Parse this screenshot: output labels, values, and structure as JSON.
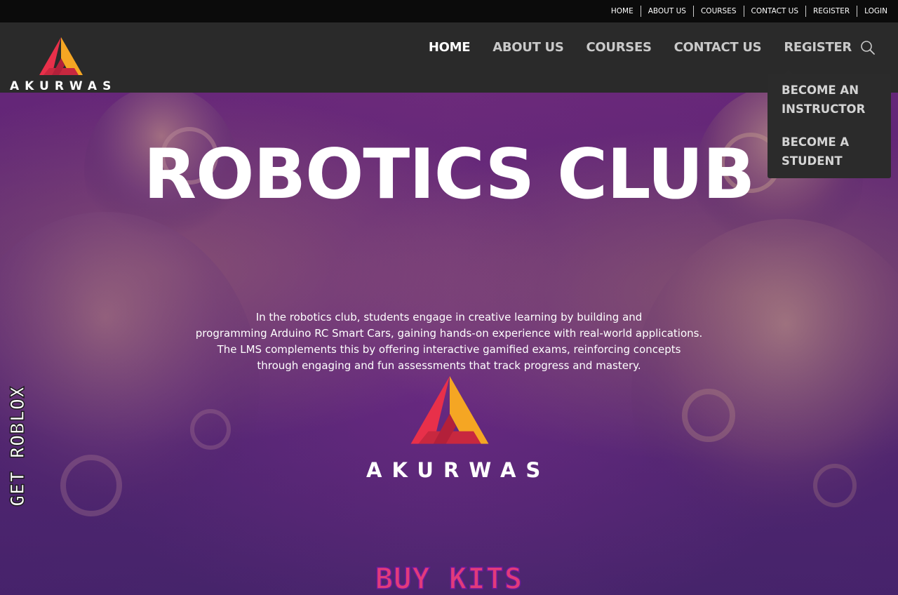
{
  "topbar": {
    "links": [
      "HOME",
      "ABOUT US",
      "COURSES",
      "CONTACT US",
      "REGISTER",
      "LOGIN"
    ]
  },
  "header": {
    "logo_text": "AKURWAS",
    "nav": [
      "HOME",
      "ABOUT US",
      "COURSES",
      "CONTACT US",
      "REGISTER"
    ],
    "active_nav": "HOME",
    "search_icon": "search-icon"
  },
  "dropdown": {
    "items": [
      "BECOME AN INSTRUCTOR",
      "BECOME A STUDENT"
    ]
  },
  "hero": {
    "title": "ROBOTICS CLUB",
    "description": [
      "In the robotics club, students engage in creative learning by building and",
      "programming Arduino RC Smart Cars, gaining hands-on experience with real-world applications.",
      "The LMS complements this by offering interactive gamified exams, reinforcing concepts",
      "through engaging and fun assessments that track progress and mastery."
    ],
    "logo_text": "AKURWAS",
    "side_tab": "GET ROBLOX",
    "buy_kits": "BUY KITS"
  },
  "colors": {
    "logo_red": "#e8304a",
    "logo_orange": "#f5a623",
    "buy_kits": "#e23a7b"
  }
}
